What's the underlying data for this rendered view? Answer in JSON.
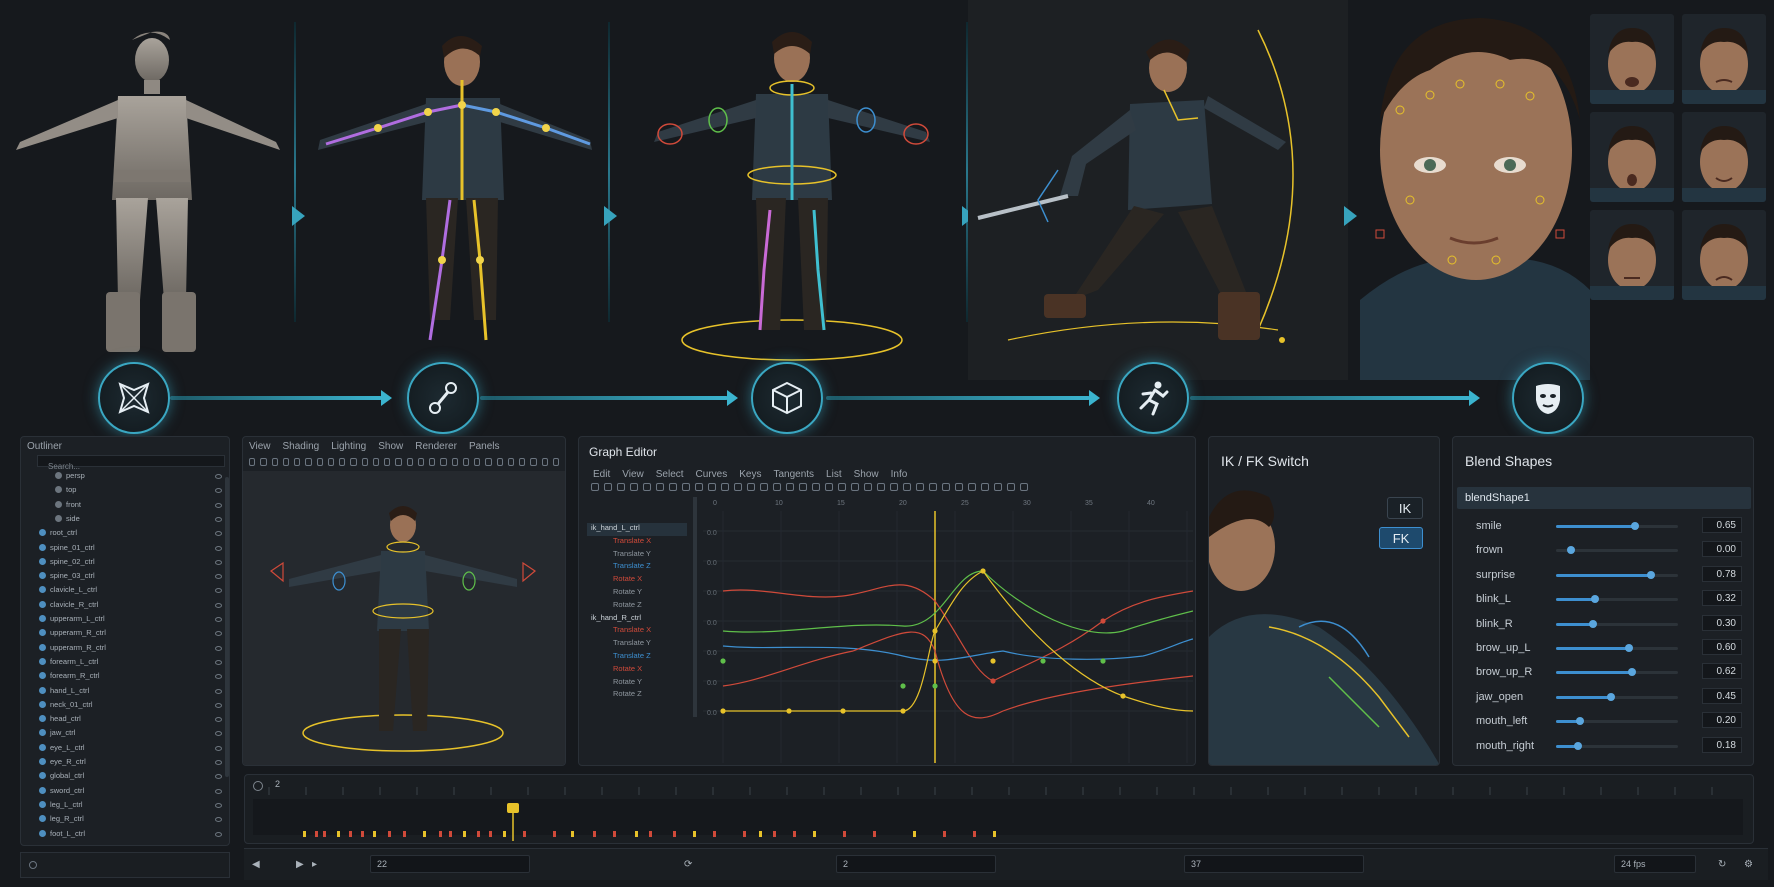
{
  "outliner": {
    "title": "Outliner",
    "search_placeholder": "Search...",
    "items": [
      "persp",
      "top",
      "front",
      "side",
      "root_ctrl",
      "spine_01_ctrl",
      "spine_02_ctrl",
      "spine_03_ctrl",
      "clavicle_L_ctrl",
      "clavicle_R_ctrl",
      "upperarm_L_ctrl",
      "upperarm_R_ctrl",
      "upperarm_R_ctrl",
      "forearm_L_ctrl",
      "forearm_R_ctrl",
      "hand_L_ctrl",
      "neck_01_ctrl",
      "head_ctrl",
      "jaw_ctrl",
      "eye_L_ctrl",
      "eye_R_ctrl",
      "global_ctrl",
      "sword_ctrl",
      "leg_L_ctrl",
      "leg_R_ctrl",
      "foot_L_ctrl"
    ]
  },
  "viewport": {
    "menu": [
      "View",
      "Shading",
      "Lighting",
      "Show",
      "Renderer",
      "Panels"
    ]
  },
  "graph_editor": {
    "title": "Graph Editor",
    "menu": [
      "Edit",
      "View",
      "Select",
      "Curves",
      "Keys",
      "Tangents",
      "List",
      "Show",
      "Info"
    ],
    "channels": [
      {
        "label": "ik_hand_L_ctrl",
        "kind": "node"
      },
      {
        "label": "Translate X",
        "kind": "red"
      },
      {
        "label": "Translate Y",
        "kind": "grey"
      },
      {
        "label": "Translate Z",
        "kind": "blue"
      },
      {
        "label": "Rotate X",
        "kind": "red"
      },
      {
        "label": "Rotate Y",
        "kind": "grey"
      },
      {
        "label": "Rotate Z",
        "kind": "grey"
      },
      {
        "label": "ik_hand_R_ctrl",
        "kind": "node"
      },
      {
        "label": "Translate X",
        "kind": "red"
      },
      {
        "label": "Translate Y",
        "kind": "grey"
      },
      {
        "label": "Translate Z",
        "kind": "blue"
      },
      {
        "label": "Rotate X",
        "kind": "red"
      },
      {
        "label": "Rotate Y",
        "kind": "grey"
      },
      {
        "label": "Rotate Z",
        "kind": "grey"
      }
    ],
    "ruler": [
      "0",
      "10",
      "15",
      "20",
      "25",
      "30",
      "35",
      "40"
    ],
    "y_ticks": [
      "0.0",
      "0.0",
      "0.0",
      "0.0",
      "0.0",
      "0.0",
      "0.0"
    ]
  },
  "ikfk": {
    "title": "IK / FK Switch",
    "fk_label": "FK",
    "ik_label": "IK"
  },
  "blend_shapes": {
    "title": "Blend Shapes",
    "node": "blendShape1",
    "items": [
      {
        "name": "smile",
        "value": 0.65,
        "text": "0.65"
      },
      {
        "name": "frown",
        "value": 0.0,
        "text": "0.00"
      },
      {
        "name": "surprise",
        "value": 0.78,
        "text": "0.78"
      },
      {
        "name": "blink_L",
        "value": 0.32,
        "text": "0.32"
      },
      {
        "name": "blink_R",
        "value": 0.3,
        "text": "0.30"
      },
      {
        "name": "brow_up_L",
        "value": 0.6,
        "text": "0.60"
      },
      {
        "name": "brow_up_R",
        "value": 0.62,
        "text": "0.62"
      },
      {
        "name": "jaw_open",
        "value": 0.45,
        "text": "0.45"
      },
      {
        "name": "mouth_left",
        "value": 0.2,
        "text": "0.20"
      },
      {
        "name": "mouth_right",
        "value": 0.18,
        "text": "0.18"
      }
    ]
  },
  "timeline": {
    "current_frame": "2",
    "start_field": "22",
    "mid_field": "2",
    "end_field": "37",
    "fps": "24 fps"
  },
  "pipeline_icons": [
    "mesh-icon",
    "bone-icon",
    "cube-icon",
    "running-figure-icon",
    "face-mask-icon"
  ],
  "colors": {
    "accent": "#3aa7c2",
    "key_yellow": "#e7c22a",
    "curve_red": "#d04a3a",
    "curve_green": "#5fbf4a",
    "curve_blue": "#3d8fd0"
  }
}
